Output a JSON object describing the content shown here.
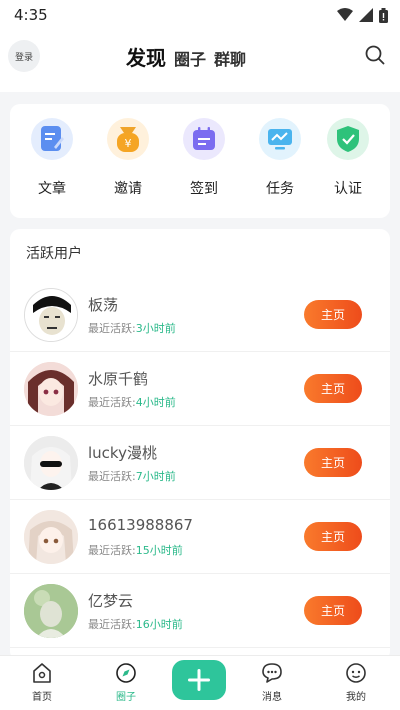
{
  "status_bar": {
    "time": "4:35",
    "icons": [
      "wifi-icon",
      "signal-icon",
      "battery-icon"
    ]
  },
  "header": {
    "login_label": "登录",
    "tabs": [
      {
        "label": "发现",
        "active": true
      },
      {
        "label": "圈子",
        "active": false
      },
      {
        "label": "群聊",
        "active": false
      }
    ],
    "search_icon": "search-icon"
  },
  "shortcuts": [
    {
      "label": "文章",
      "icon": "article-icon",
      "color": "#5b8ef0"
    },
    {
      "label": "邀请",
      "icon": "invite-icon",
      "color": "#f5a524"
    },
    {
      "label": "签到",
      "icon": "checkin-icon",
      "color": "#7b6cf0"
    },
    {
      "label": "任务",
      "icon": "task-icon",
      "color": "#4ab4ee"
    },
    {
      "label": "认证",
      "icon": "verify-icon",
      "color": "#2ec27a"
    }
  ],
  "active_users": {
    "title": "活跃用户",
    "meta_prefix": "最近活跃:",
    "button_label": "主页",
    "users": [
      {
        "name": "板荡",
        "active_ago": "3小时前"
      },
      {
        "name": "水原千鹤",
        "active_ago": "4小时前"
      },
      {
        "name": "lucky漫桃",
        "active_ago": "7小时前"
      },
      {
        "name": "16613988867",
        "active_ago": "15小时前"
      },
      {
        "name": "亿梦云",
        "active_ago": "16小时前"
      }
    ]
  },
  "bottom_nav": {
    "items": [
      {
        "label": "首页",
        "icon": "home-icon",
        "active": false
      },
      {
        "label": "圈子",
        "icon": "compass-icon",
        "active": true
      },
      {
        "label": "",
        "icon": "plus-icon",
        "active": false
      },
      {
        "label": "消息",
        "icon": "message-icon",
        "active": false
      },
      {
        "label": "我的",
        "icon": "profile-icon",
        "active": false
      }
    ]
  },
  "colors": {
    "accent": "#2bb98a",
    "button_gradient_start": "#f97a2c",
    "button_gradient_end": "#ee4c1b"
  }
}
